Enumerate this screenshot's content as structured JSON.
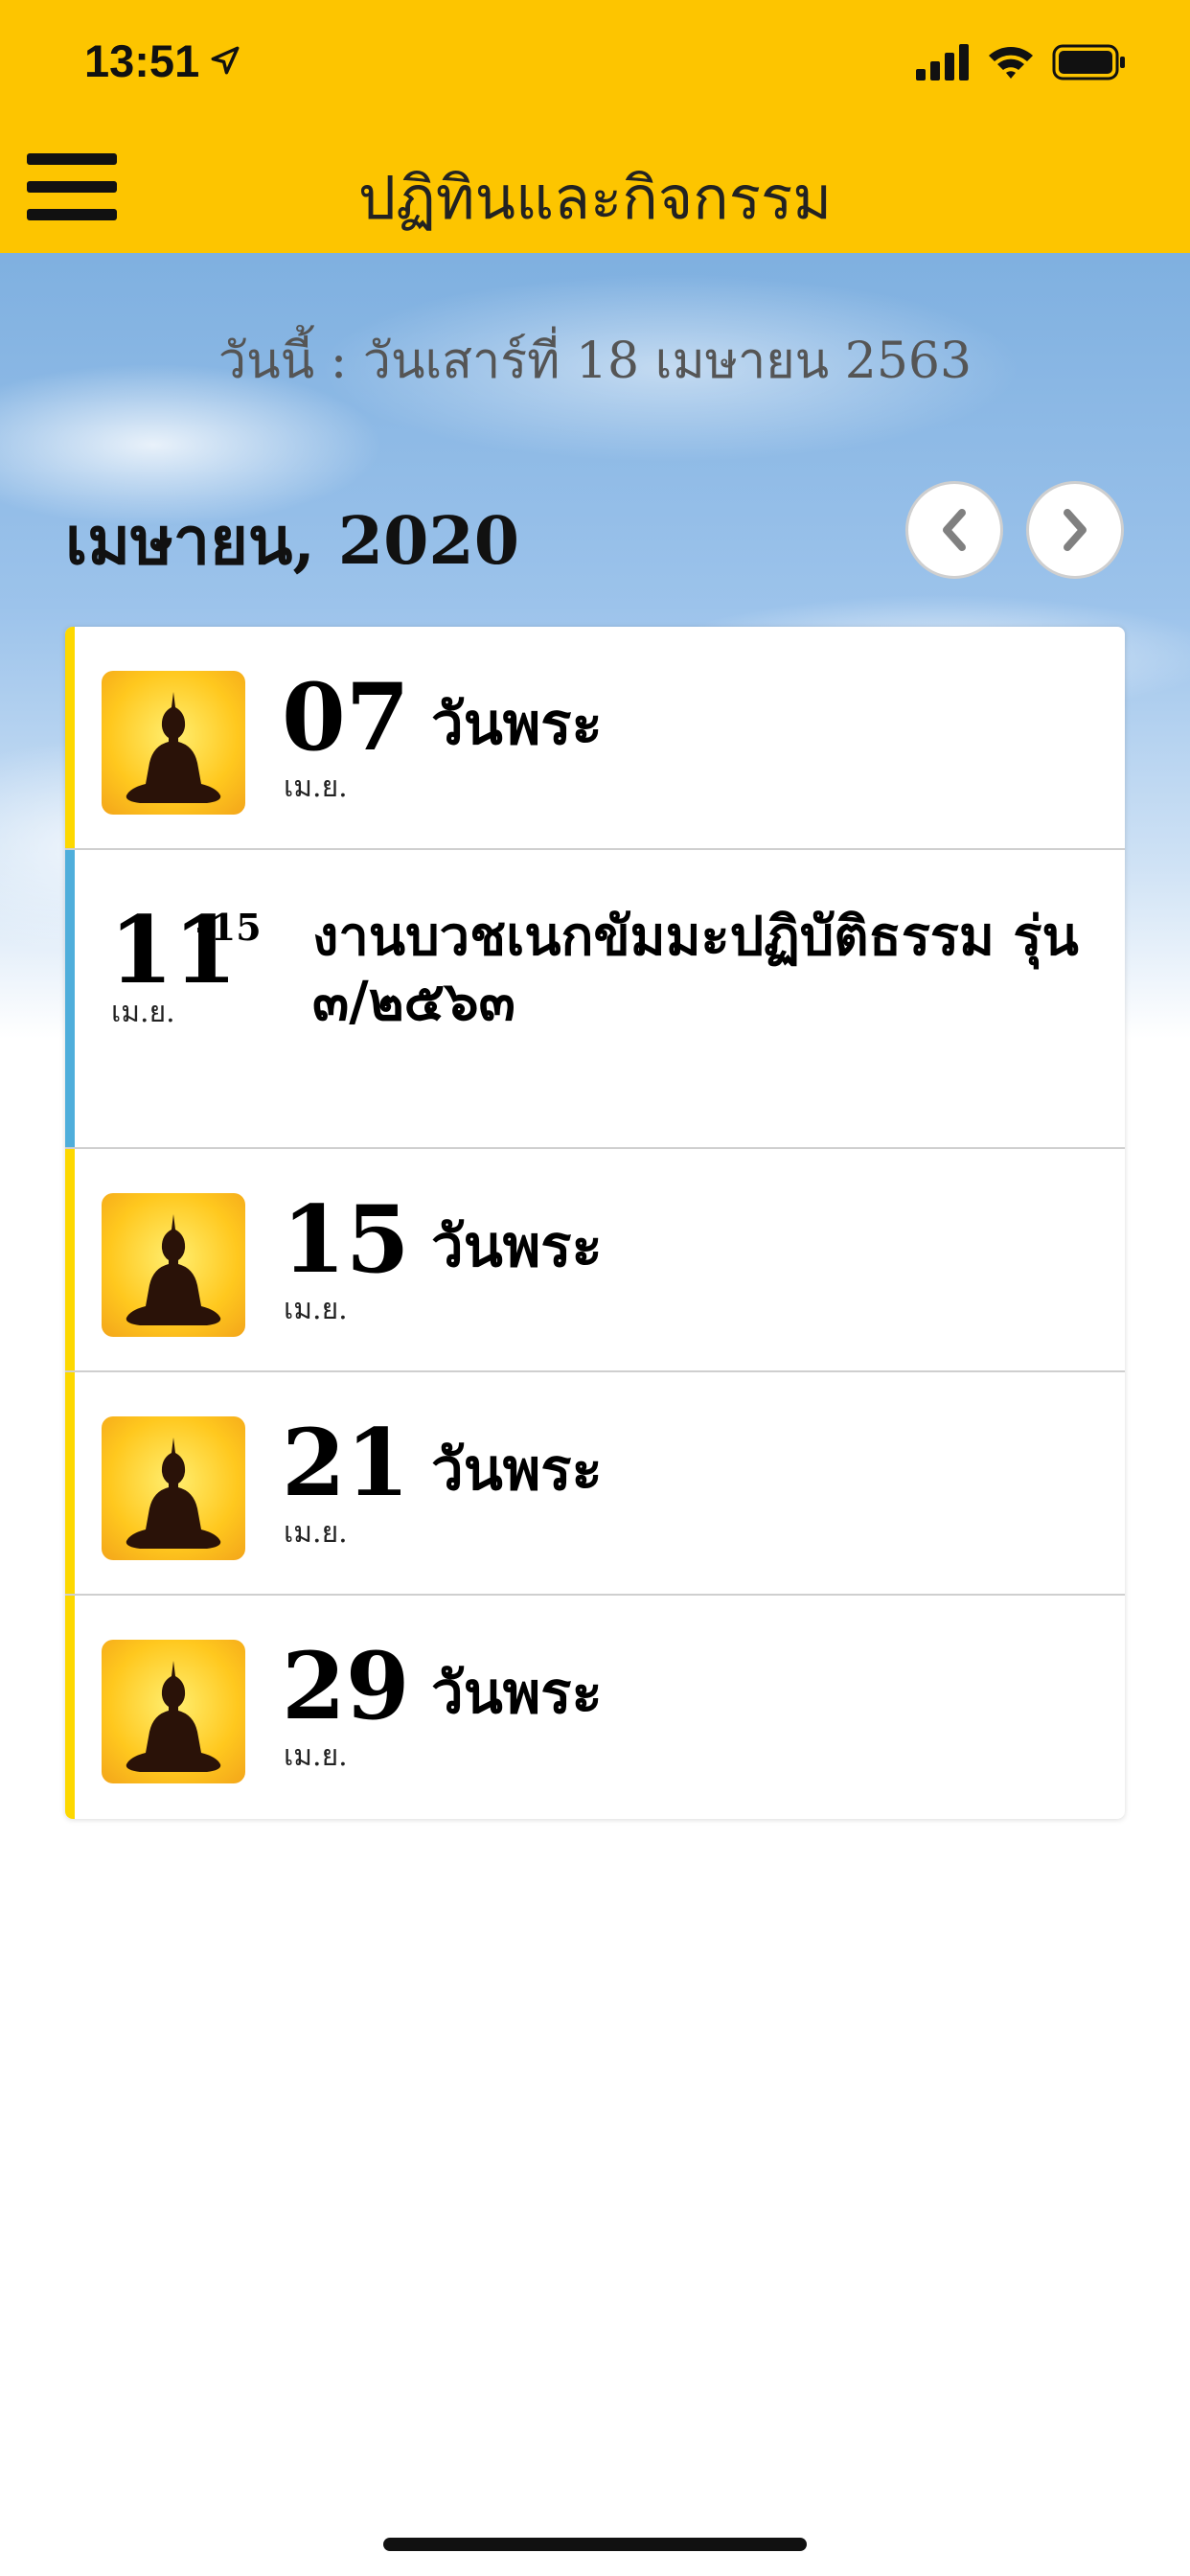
{
  "status_bar": {
    "time": "13:51"
  },
  "header": {
    "title": "ปฏิทินและกิจกรรม"
  },
  "today_text": "วันนี้ : วันเสาร์ที่ 18 เมษายน 2563",
  "calendar": {
    "month_label": "เมษายน, 2020"
  },
  "events": [
    {
      "type": "holy_day",
      "day": "07",
      "month": "เม.ย.",
      "title": "วันพระ"
    },
    {
      "type": "event",
      "day": "11",
      "range_end": "-15",
      "month": "เม.ย.",
      "title": "งานบวชเนกขัมมะปฏิบัติธรรม รุ่น ๓/๒๕๖๓"
    },
    {
      "type": "holy_day",
      "day": "15",
      "month": "เม.ย.",
      "title": "วันพระ"
    },
    {
      "type": "holy_day",
      "day": "21",
      "month": "เม.ย.",
      "title": "วันพระ"
    },
    {
      "type": "holy_day",
      "day": "29",
      "month": "เม.ย.",
      "title": "วันพระ"
    }
  ],
  "colors": {
    "header": "#FDC500",
    "holy_bar": "#FDD800",
    "event_bar": "#4FAEDB"
  },
  "icons": {
    "menu": "hamburger-menu-icon",
    "prev": "chevron-left-icon",
    "next": "chevron-right-icon",
    "holy_day": "buddha-icon"
  }
}
